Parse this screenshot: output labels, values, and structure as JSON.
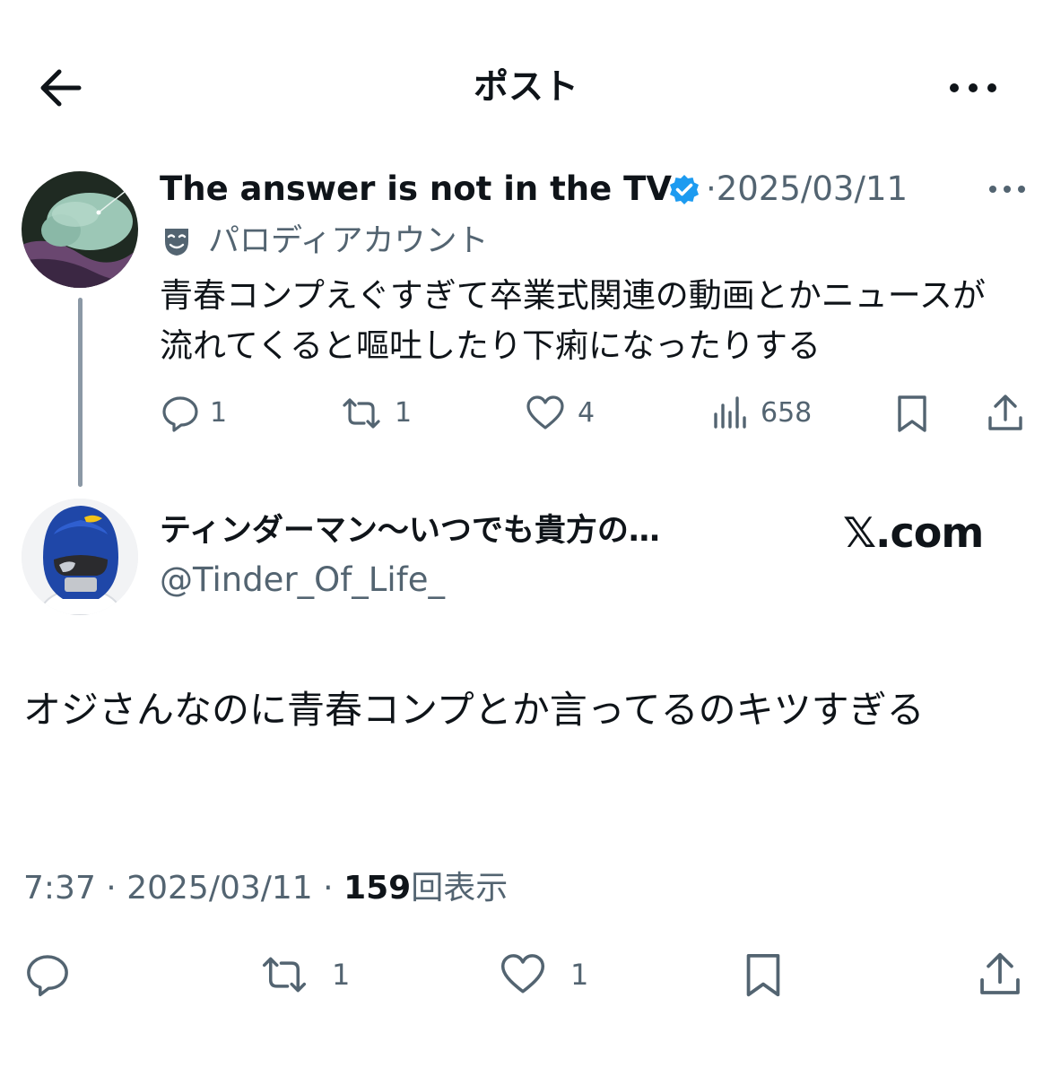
{
  "header": {
    "title": "ポスト",
    "back_icon": "arrow-left-icon",
    "more_icon": "more-horizontal-icon"
  },
  "parent_post": {
    "display_name": "The answer is not in the TV",
    "verified": true,
    "separator": "·",
    "date": "2025/03/11",
    "parody_label": "パロディアカウント",
    "text": "青春コンプえぐすぎて卒業式関連の動画とかニュースが流れてくると嘔吐したり下痢になったりする",
    "actions": {
      "replies": "1",
      "reposts": "1",
      "likes": "4",
      "views": "658"
    }
  },
  "reply_post": {
    "display_name": "ティンダーマン〜いつでも貴方の…",
    "handle": "@Tinder_Of_Life_",
    "watermark": "𝕏.com",
    "text": "オジさんなのに青春コンプとか言ってるのキツすぎる",
    "time": "7:37",
    "date": "2025/03/11",
    "separator": "·",
    "view_count": "159",
    "view_label": "回表示",
    "actions": {
      "reposts": "1",
      "likes": "1"
    }
  },
  "colors": {
    "text_primary": "#0f1419",
    "text_secondary": "#536471",
    "verified_blue": "#1d9bf0",
    "thread_line": "#8b98a5",
    "background": "#ffffff"
  }
}
